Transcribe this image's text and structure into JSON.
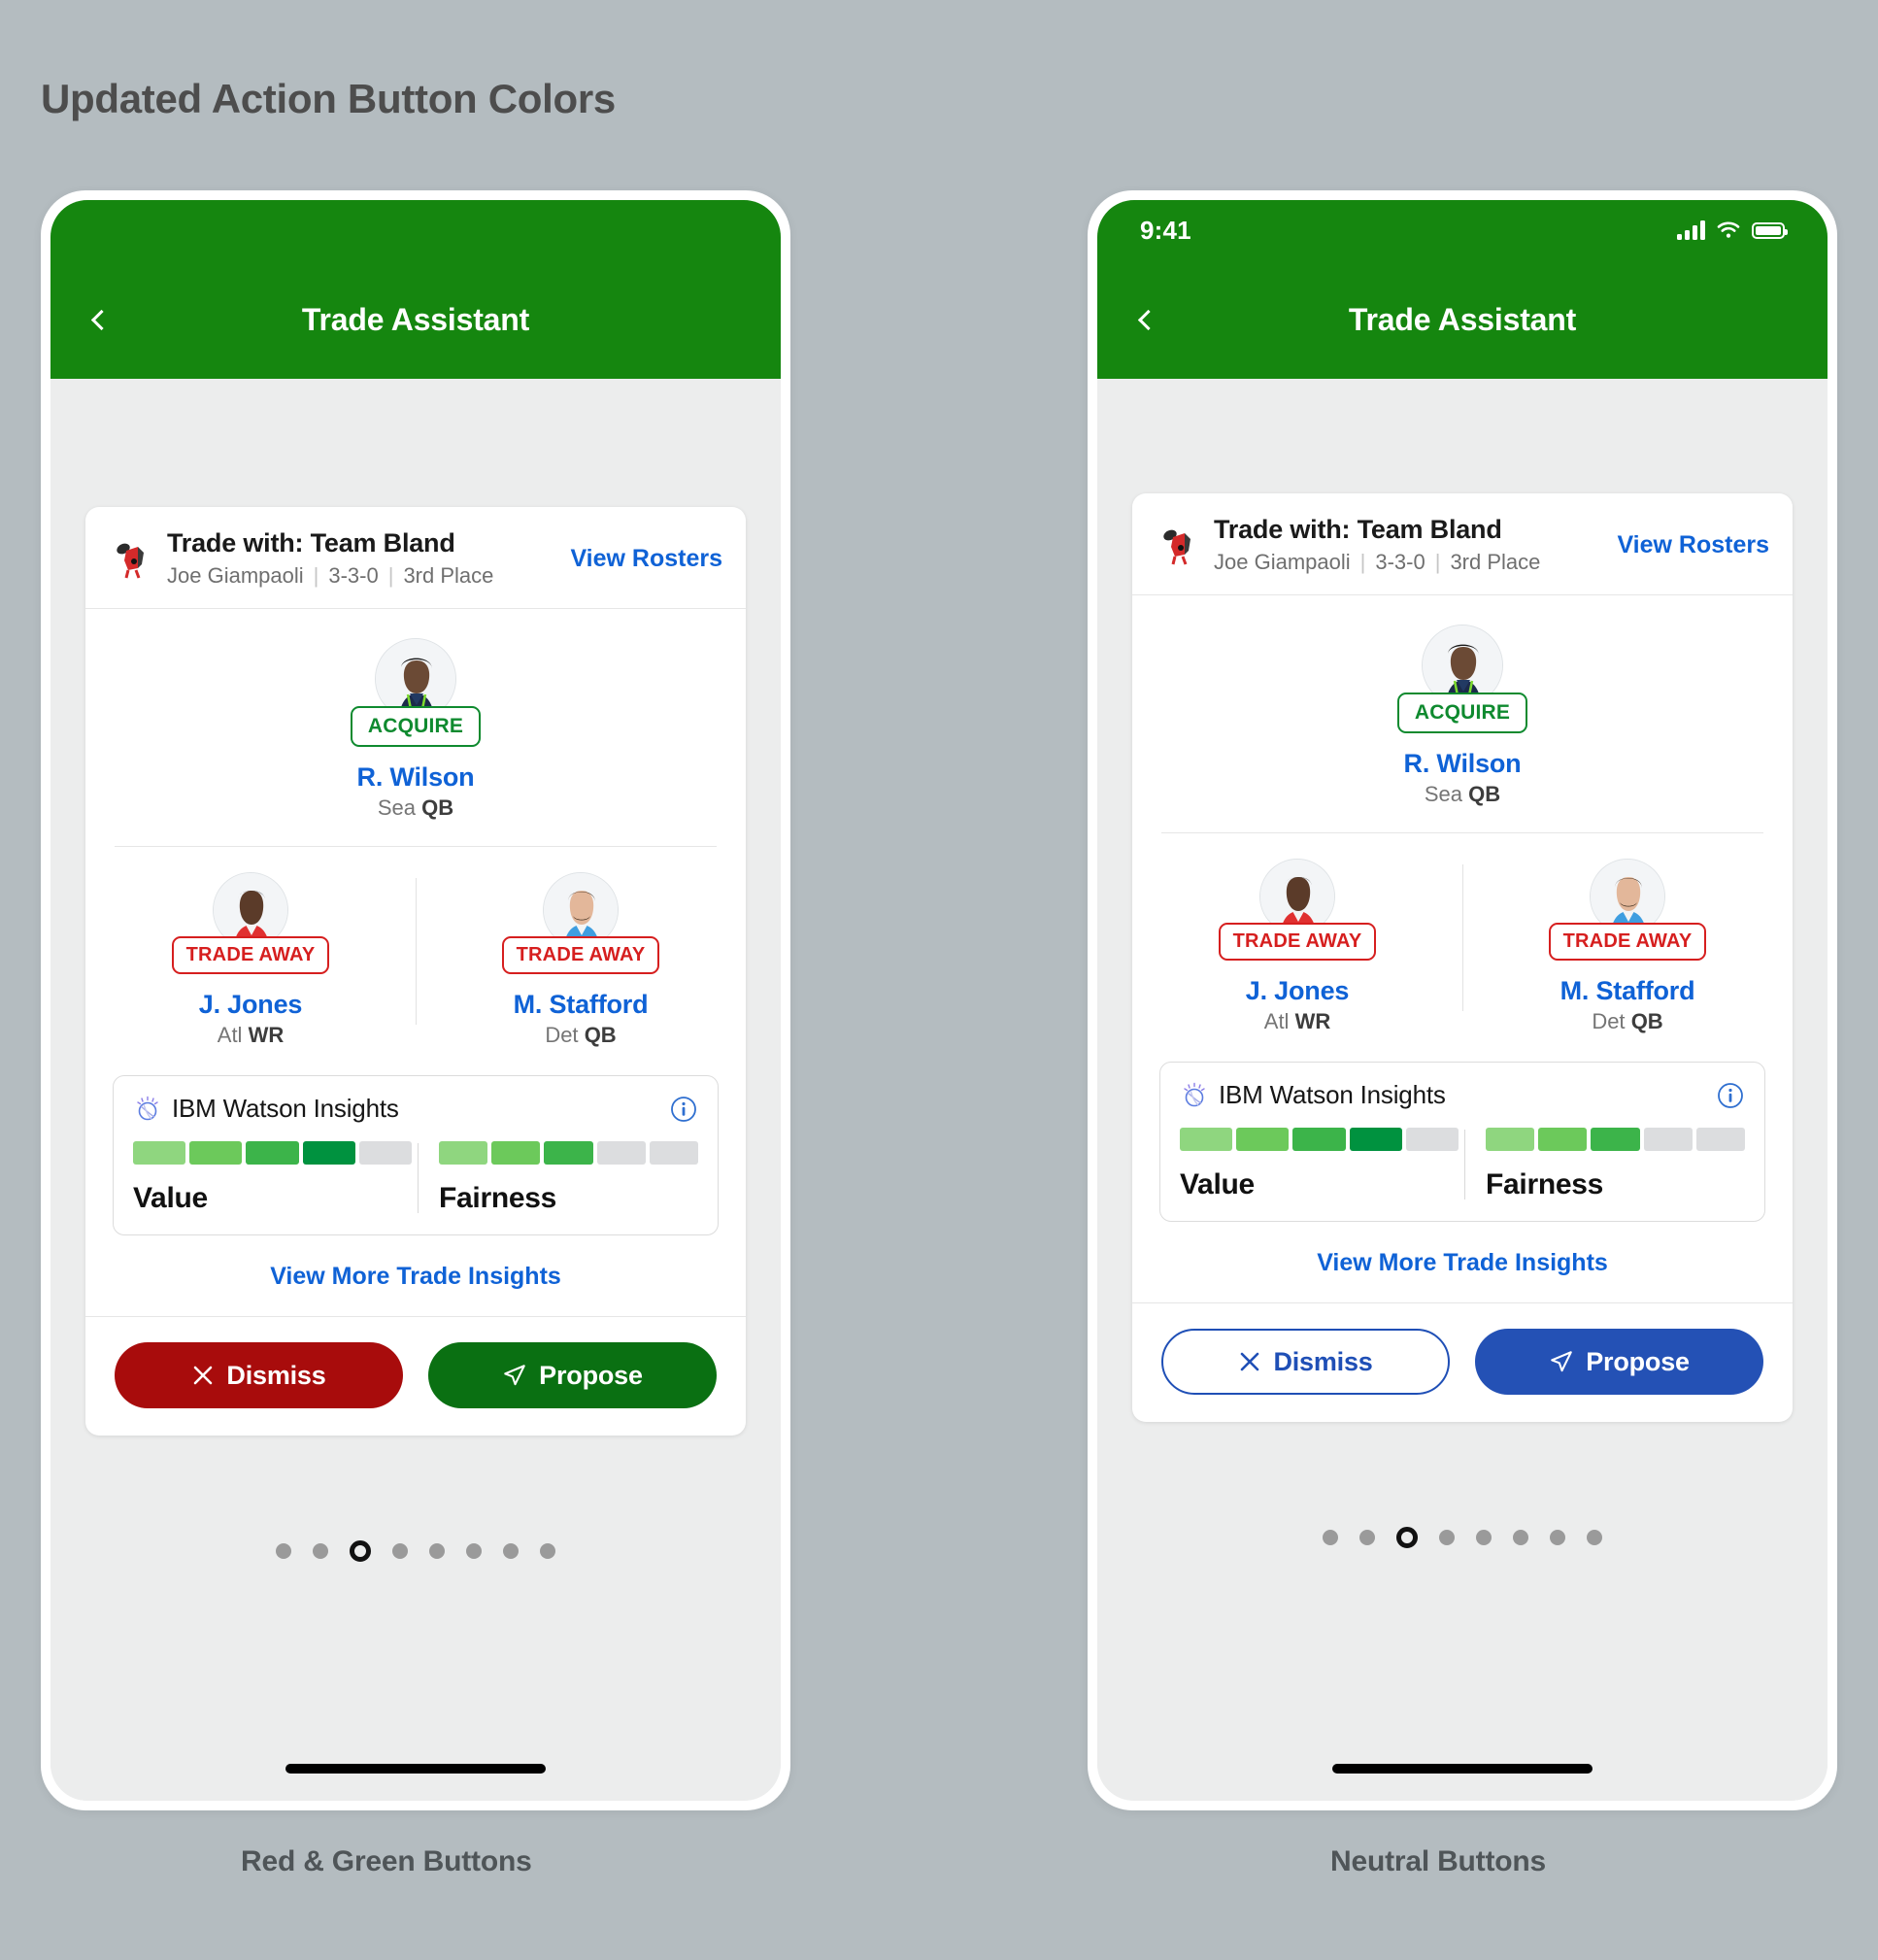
{
  "page": {
    "title": "Updated Action Button Colors",
    "background_color": "#b4bcc0"
  },
  "captions": {
    "left": "Red & Green Buttons",
    "right": "Neutral Buttons"
  },
  "colors": {
    "nav_green": "#15860f",
    "link_blue": "#0f62d6",
    "acquire_green": "#0f8a2f",
    "trade_away_red": "#d61f1f",
    "dismiss_red": "#a80c0c",
    "propose_green": "#0a7012",
    "neutral_blue": "#2451b5",
    "meter_filled_dark": "#00923f",
    "meter_empty": "#dcdddf"
  },
  "screens": [
    {
      "id": "red-green",
      "status_bar": {
        "visible": false,
        "time": "",
        "icons": []
      },
      "nav": {
        "title": "Trade Assistant",
        "back_icon": "chevron-left-icon"
      },
      "card": {
        "header": {
          "logo_icon": "team-logo-icon",
          "title": "Trade with: Team Bland",
          "manager": "Joe Giampaoli",
          "record": "3-3-0",
          "standing": "3rd Place",
          "action_link": "View Rosters"
        },
        "acquire": {
          "badge": "ACQUIRE",
          "name": "R. Wilson",
          "team": "Sea",
          "position": "QB"
        },
        "trade_away": [
          {
            "badge": "TRADE AWAY",
            "name": "J. Jones",
            "team": "Atl",
            "position": "WR"
          },
          {
            "badge": "TRADE AWAY",
            "name": "M. Stafford",
            "team": "Det",
            "position": "QB"
          }
        ],
        "insights": {
          "brand": "IBM Watson Insights",
          "logo_icon": "watson-logo-icon",
          "info_icon": "info-circle-icon",
          "meters": [
            {
              "label": "Value",
              "filled": 4,
              "total": 5
            },
            {
              "label": "Fairness",
              "filled": 3,
              "total": 5
            }
          ]
        },
        "more_link": "View More Trade Insights",
        "buttons": {
          "dismiss": {
            "label": "Dismiss",
            "icon": "close-x-icon",
            "style": "filled-red"
          },
          "propose": {
            "label": "Propose",
            "icon": "send-paperplane-icon",
            "style": "filled-green"
          }
        }
      },
      "pagination": {
        "total": 8,
        "active_index": 2
      }
    },
    {
      "id": "neutral",
      "status_bar": {
        "visible": true,
        "time": "9:41",
        "icons": [
          "signal-bars-icon",
          "wifi-icon",
          "battery-icon"
        ]
      },
      "nav": {
        "title": "Trade Assistant",
        "back_icon": "chevron-left-icon"
      },
      "card": {
        "header": {
          "logo_icon": "team-logo-icon",
          "title": "Trade with: Team Bland",
          "manager": "Joe Giampaoli",
          "record": "3-3-0",
          "standing": "3rd Place",
          "action_link": "View Rosters"
        },
        "acquire": {
          "badge": "ACQUIRE",
          "name": "R. Wilson",
          "team": "Sea",
          "position": "QB"
        },
        "trade_away": [
          {
            "badge": "TRADE AWAY",
            "name": "J. Jones",
            "team": "Atl",
            "position": "WR"
          },
          {
            "badge": "TRADE AWAY",
            "name": "M. Stafford",
            "team": "Det",
            "position": "QB"
          }
        ],
        "insights": {
          "brand": "IBM Watson Insights",
          "logo_icon": "watson-logo-icon",
          "info_icon": "info-circle-icon",
          "meters": [
            {
              "label": "Value",
              "filled": 4,
              "total": 5
            },
            {
              "label": "Fairness",
              "filled": 3,
              "total": 5
            }
          ]
        },
        "more_link": "View More Trade Insights",
        "buttons": {
          "dismiss": {
            "label": "Dismiss",
            "icon": "close-x-icon",
            "style": "outline-blue"
          },
          "propose": {
            "label": "Propose",
            "icon": "send-paperplane-icon",
            "style": "filled-blue"
          }
        }
      },
      "pagination": {
        "total": 8,
        "active_index": 2
      }
    }
  ]
}
